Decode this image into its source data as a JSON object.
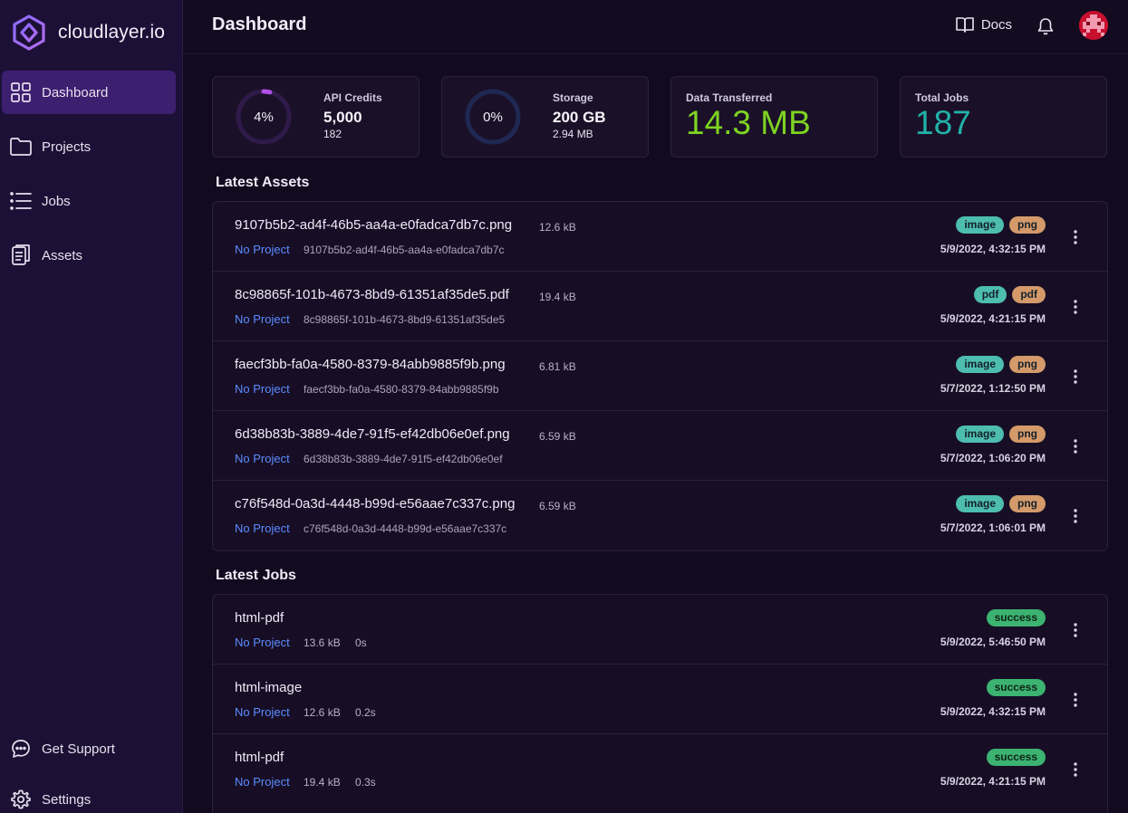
{
  "brand": {
    "name": "cloudlayer.io"
  },
  "sidebar": {
    "items": [
      {
        "label": "Dashboard",
        "icon": "grid-icon",
        "active": true
      },
      {
        "label": "Projects",
        "icon": "folder-icon"
      },
      {
        "label": "Jobs",
        "icon": "list-icon"
      },
      {
        "label": "Assets",
        "icon": "documents-icon"
      }
    ],
    "bottom": [
      {
        "label": "Get Support",
        "icon": "chat-icon"
      },
      {
        "label": "Settings",
        "icon": "gear-icon"
      }
    ]
  },
  "header": {
    "title": "Dashboard",
    "docs_label": "Docs"
  },
  "stats": {
    "api_credits": {
      "title": "API Credits",
      "percent_label": "4%",
      "percent": 0.04,
      "value": "5,000",
      "sub": "182"
    },
    "storage": {
      "title": "Storage",
      "percent_label": "0%",
      "percent": 0.0,
      "value": "200 GB",
      "sub": "2.94 MB"
    },
    "data_transferred": {
      "title": "Data Transferred",
      "value": "14.3 MB"
    },
    "total_jobs": {
      "title": "Total Jobs",
      "value": "187"
    }
  },
  "assets": {
    "title": "Latest Assets",
    "rows": [
      {
        "name": "9107b5b2-ad4f-46b5-aa4a-e0fadca7db7c.png",
        "size": "12.6 kB",
        "project": "No Project",
        "hash": "9107b5b2-ad4f-46b5-aa4a-e0fadca7db7c",
        "tags": [
          "image",
          "png"
        ],
        "date": "5/9/2022, 4:32:15 PM"
      },
      {
        "name": "8c98865f-101b-4673-8bd9-61351af35de5.pdf",
        "size": "19.4 kB",
        "project": "No Project",
        "hash": "8c98865f-101b-4673-8bd9-61351af35de5",
        "tags": [
          "pdf",
          "pdf"
        ],
        "date": "5/9/2022, 4:21:15 PM"
      },
      {
        "name": "faecf3bb-fa0a-4580-8379-84abb9885f9b.png",
        "size": "6.81 kB",
        "project": "No Project",
        "hash": "faecf3bb-fa0a-4580-8379-84abb9885f9b",
        "tags": [
          "image",
          "png"
        ],
        "date": "5/7/2022, 1:12:50 PM"
      },
      {
        "name": "6d38b83b-3889-4de7-91f5-ef42db06e0ef.png",
        "size": "6.59 kB",
        "project": "No Project",
        "hash": "6d38b83b-3889-4de7-91f5-ef42db06e0ef",
        "tags": [
          "image",
          "png"
        ],
        "date": "5/7/2022, 1:06:20 PM"
      },
      {
        "name": "c76f548d-0a3d-4448-b99d-e56aae7c337c.png",
        "size": "6.59 kB",
        "project": "No Project",
        "hash": "c76f548d-0a3d-4448-b99d-e56aae7c337c",
        "tags": [
          "image",
          "png"
        ],
        "date": "5/7/2022, 1:06:01 PM"
      }
    ]
  },
  "jobs": {
    "title": "Latest Jobs",
    "rows": [
      {
        "name": "html-pdf",
        "project": "No Project",
        "size": "13.6 kB",
        "duration": "0s",
        "status": "success",
        "date": "5/9/2022, 5:46:50 PM"
      },
      {
        "name": "html-image",
        "project": "No Project",
        "size": "12.6 kB",
        "duration": "0.2s",
        "status": "success",
        "date": "5/9/2022, 4:32:15 PM"
      },
      {
        "name": "html-pdf",
        "project": "No Project",
        "size": "19.4 kB",
        "duration": "0.3s",
        "status": "success",
        "date": "5/9/2022, 4:21:15 PM"
      }
    ]
  },
  "colors": {
    "accent": "#3d1f70",
    "ring_api": "#b04fe8",
    "ring_storage": "#2b3a8c",
    "data_transferred": "#7ed321",
    "total_jobs": "#21b3a8",
    "link": "#5b8cff",
    "tag_teal": "#4dbdb0",
    "tag_orange": "#d49a6a",
    "tag_success": "#3cb371"
  }
}
